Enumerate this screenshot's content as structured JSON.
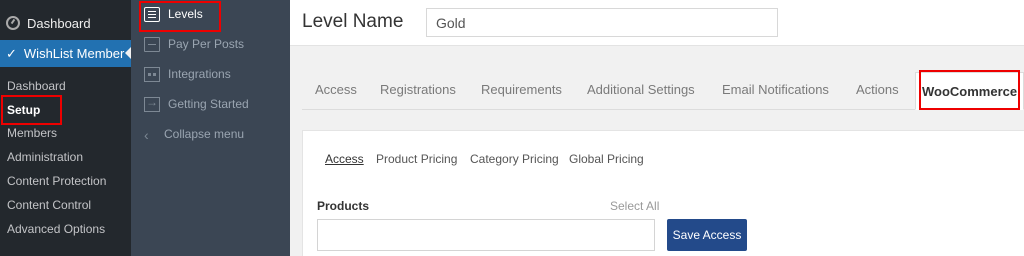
{
  "admin_menu": {
    "dashboard": "Dashboard",
    "plugin": "WishList Member",
    "submenu": [
      "Dashboard",
      "Setup",
      "Members",
      "Administration",
      "Content Protection",
      "Content Control",
      "Advanced Options"
    ]
  },
  "sidebar": {
    "items": [
      {
        "label": "Levels",
        "icon": "list-icon"
      },
      {
        "label": "Pay Per Posts",
        "icon": "document-icon"
      },
      {
        "label": "Integrations",
        "icon": "calendar-icon"
      },
      {
        "label": "Getting Started",
        "icon": "enter-icon"
      },
      {
        "label": "Collapse menu",
        "icon": "chevron-left-icon"
      }
    ]
  },
  "header": {
    "title": "Level Name",
    "level_value": "Gold"
  },
  "tabs": [
    "Access",
    "Registrations",
    "Requirements",
    "Additional Settings",
    "Email Notifications",
    "Actions",
    "WooCommerce"
  ],
  "active_tab": "WooCommerce",
  "subtabs": [
    "Access",
    "Product Pricing",
    "Category Pricing",
    "Global Pricing"
  ],
  "active_subtab": "Access",
  "form": {
    "products_label": "Products",
    "select_all": "Select All",
    "products_value": "",
    "save_label": "Save Access"
  },
  "colors": {
    "admin_bg": "#23282d",
    "wishlist_active": "#2271b1",
    "sidebar_bg": "#3b4654",
    "save_button": "#234a8a",
    "highlight": "#ee0000"
  }
}
